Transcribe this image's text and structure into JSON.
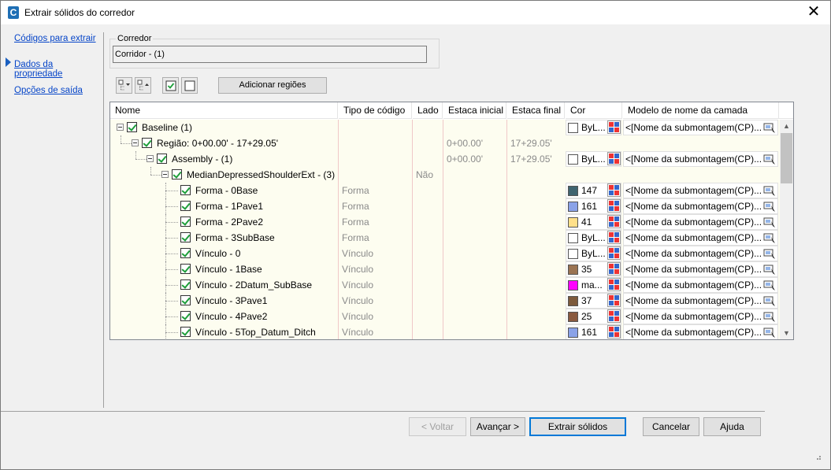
{
  "window": {
    "title": "Extrair sólidos do corredor",
    "icon_letter": "C"
  },
  "nav": [
    {
      "label": "Códigos para extrair",
      "active": true
    },
    {
      "label": "Dados da propriedade",
      "active": false
    },
    {
      "label": "Opções de saída",
      "active": false
    }
  ],
  "corridor": {
    "group_label": "Corredor",
    "value": "Corridor - (1)"
  },
  "toolbar": {
    "add_regions": "Adicionar regiões"
  },
  "grid": {
    "headers": [
      "Nome",
      "Tipo de código",
      "Lado",
      "Estaca inicial",
      "Estaca final",
      "Cor",
      "Modelo de nome da camada"
    ],
    "rows": [
      {
        "level": 0,
        "name": "Baseline (1)",
        "type": "",
        "side": "",
        "start": "",
        "end": "",
        "color": "#ffffff",
        "color_label": "ByL...",
        "layer": "<[Nome da submontagem(CP)..."
      },
      {
        "level": 1,
        "name": "Região: 0+00.00' - 17+29.05'",
        "type": "",
        "side": "",
        "start": "0+00.00'",
        "end": "17+29.05'",
        "color": "",
        "color_label": "",
        "layer": ""
      },
      {
        "level": 2,
        "name": "Assembly - (1)",
        "type": "",
        "side": "",
        "start": "0+00.00'",
        "end": "17+29.05'",
        "color": "#ffffff",
        "color_label": "ByL...",
        "layer": "<[Nome da submontagem(CP)..."
      },
      {
        "level": 3,
        "name": "MedianDepressedShoulderExt - (3)",
        "type": "",
        "side": "Não",
        "start": "",
        "end": "",
        "color": "",
        "color_label": "",
        "layer": ""
      },
      {
        "level": 4,
        "name": "Forma - 0Base",
        "type": "Forma",
        "side": "",
        "start": "",
        "end": "",
        "color": "#3f6470",
        "color_label": "147",
        "layer": "<[Nome da submontagem(CP)..."
      },
      {
        "level": 4,
        "name": "Forma - 1Pave1",
        "type": "Forma",
        "side": "",
        "start": "",
        "end": "",
        "color": "#8aa2e8",
        "color_label": "161",
        "layer": "<[Nome da submontagem(CP)..."
      },
      {
        "level": 4,
        "name": "Forma - 2Pave2",
        "type": "Forma",
        "side": "",
        "start": "",
        "end": "",
        "color": "#ffe08a",
        "color_label": "41",
        "layer": "<[Nome da submontagem(CP)..."
      },
      {
        "level": 4,
        "name": "Forma - 3SubBase",
        "type": "Forma",
        "side": "",
        "start": "",
        "end": "",
        "color": "#ffffff",
        "color_label": "ByL...",
        "layer": "<[Nome da submontagem(CP)..."
      },
      {
        "level": 4,
        "name": "Vínculo - 0",
        "type": "Vínculo",
        "side": "",
        "start": "",
        "end": "",
        "color": "#ffffff",
        "color_label": "ByL...",
        "layer": "<[Nome da submontagem(CP)..."
      },
      {
        "level": 4,
        "name": "Vínculo - 1Base",
        "type": "Vínculo",
        "side": "",
        "start": "",
        "end": "",
        "color": "#9a7352",
        "color_label": "35",
        "layer": "<[Nome da submontagem(CP)..."
      },
      {
        "level": 4,
        "name": "Vínculo - 2Datum_SubBase",
        "type": "Vínculo",
        "side": "",
        "start": "",
        "end": "",
        "color": "#ff00ff",
        "color_label": "ma...",
        "layer": "<[Nome da submontagem(CP)..."
      },
      {
        "level": 4,
        "name": "Vínculo - 3Pave1",
        "type": "Vínculo",
        "side": "",
        "start": "",
        "end": "",
        "color": "#7d5a3c",
        "color_label": "37",
        "layer": "<[Nome da submontagem(CP)..."
      },
      {
        "level": 4,
        "name": "Vínculo - 4Pave2",
        "type": "Vínculo",
        "side": "",
        "start": "",
        "end": "",
        "color": "#8a5a40",
        "color_label": "25",
        "layer": "<[Nome da submontagem(CP)..."
      },
      {
        "level": 4,
        "name": "Vínculo - 5Top_Datum_Ditch",
        "type": "Vínculo",
        "side": "",
        "start": "",
        "end": "",
        "color": "#8aa2e8",
        "color_label": "161",
        "layer": "<[Nome da submontagem(CP)..."
      }
    ]
  },
  "buttons": {
    "back": "< Voltar",
    "next": "Avançar >",
    "extract": "Extrair sólidos",
    "cancel": "Cancelar",
    "help": "Ajuda"
  }
}
